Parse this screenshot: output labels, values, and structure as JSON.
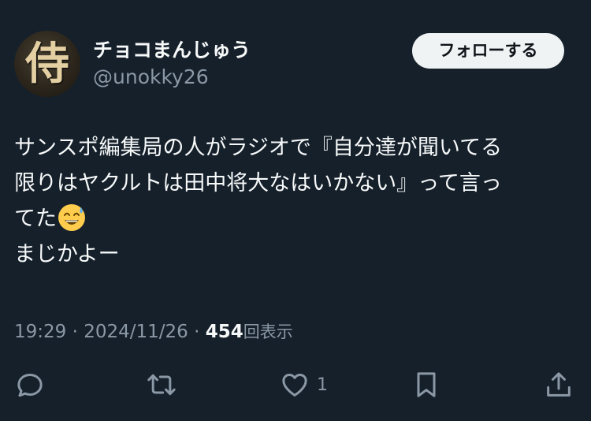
{
  "author": {
    "avatar_glyph": "侍",
    "display_name": "チョコまんじゅう",
    "handle": "@unokky26"
  },
  "follow_button": {
    "label": "フォローする"
  },
  "tweet": {
    "lines": [
      "サンスポ編集局の人がラジオで『自分達が聞いてる",
      "限りはヤクルトは田中将大なはいかない』って言っ",
      "てた",
      "まじかよー"
    ],
    "emoji": "grinning-face-with-sweat"
  },
  "meta": {
    "time": "19:29",
    "separator_1": "·",
    "date": "2024/11/26",
    "separator_2": "·",
    "views_count": "454",
    "views_label": "回表示"
  },
  "actions": {
    "reply": {
      "icon": "reply-icon"
    },
    "retweet": {
      "icon": "retweet-icon"
    },
    "like": {
      "icon": "heart-icon",
      "count": "1"
    },
    "bookmark": {
      "icon": "bookmark-icon"
    },
    "share": {
      "icon": "share-icon"
    }
  },
  "colors": {
    "background": "#15202b",
    "text_primary": "#f7f9f9",
    "text_secondary": "#8b98a5",
    "follow_button_bg": "#eff3f4",
    "follow_button_text": "#0f1419"
  }
}
